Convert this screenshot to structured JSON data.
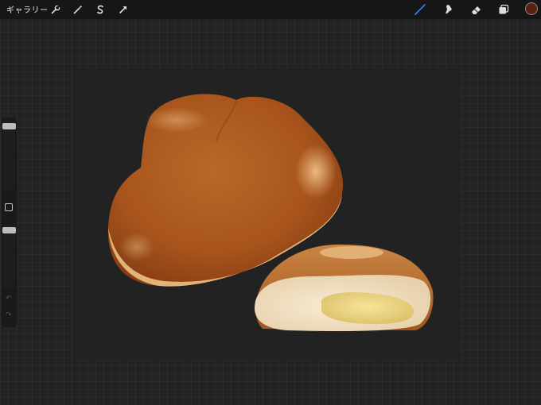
{
  "toolbar": {
    "gallery_label": "ギャラリー",
    "left_icons": [
      "wrench-icon",
      "magic-wand-icon",
      "selection-s-icon",
      "transform-arrow-icon"
    ],
    "right_icons": [
      "brush-icon",
      "smudge-icon",
      "eraser-icon",
      "layers-icon",
      "color-swatch"
    ],
    "active_tool": "brush",
    "current_color": "#5a2010",
    "accent_color": "#3c7df0"
  },
  "sidebar": {
    "brush_size_level": 0.05,
    "opacity_level": 0.05,
    "modify_button_icon": "square-icon",
    "undo_icon": "undo-icon",
    "redo_icon": "redo-icon"
  },
  "canvas": {
    "artwork": "two-bread-buns-illustration",
    "background_color": "#222222"
  }
}
